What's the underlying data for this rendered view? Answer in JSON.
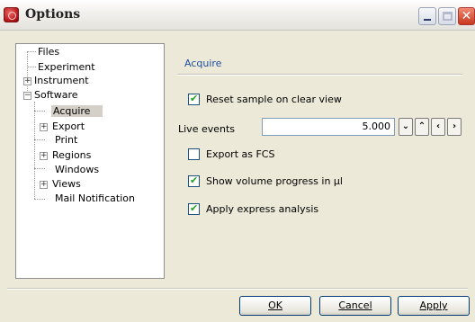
{
  "window": {
    "title": "Options"
  },
  "tree": {
    "items": [
      {
        "label": "Files"
      },
      {
        "label": "Experiment"
      },
      {
        "label": "Instrument"
      },
      {
        "label": "Software"
      },
      {
        "label": "Acquire",
        "selected": true
      },
      {
        "label": "Export"
      },
      {
        "label": "Print"
      },
      {
        "label": "Regions"
      },
      {
        "label": "Windows"
      },
      {
        "label": "Views"
      },
      {
        "label": "Mail Notification"
      }
    ]
  },
  "section": {
    "title": "Acquire"
  },
  "options": {
    "reset_sample": {
      "label": "Reset sample on clear view",
      "checked": true
    },
    "live_events": {
      "label": "Live events",
      "value": "5.000"
    },
    "export_fcs": {
      "label": "Export as FCS",
      "checked": false
    },
    "show_volume": {
      "label": "Show volume progress in µl",
      "checked": true
    },
    "express_analysis": {
      "label": "Apply express analysis",
      "checked": true
    }
  },
  "buttons": {
    "ok": "OK",
    "cancel": "Cancel",
    "apply": "Apply"
  }
}
